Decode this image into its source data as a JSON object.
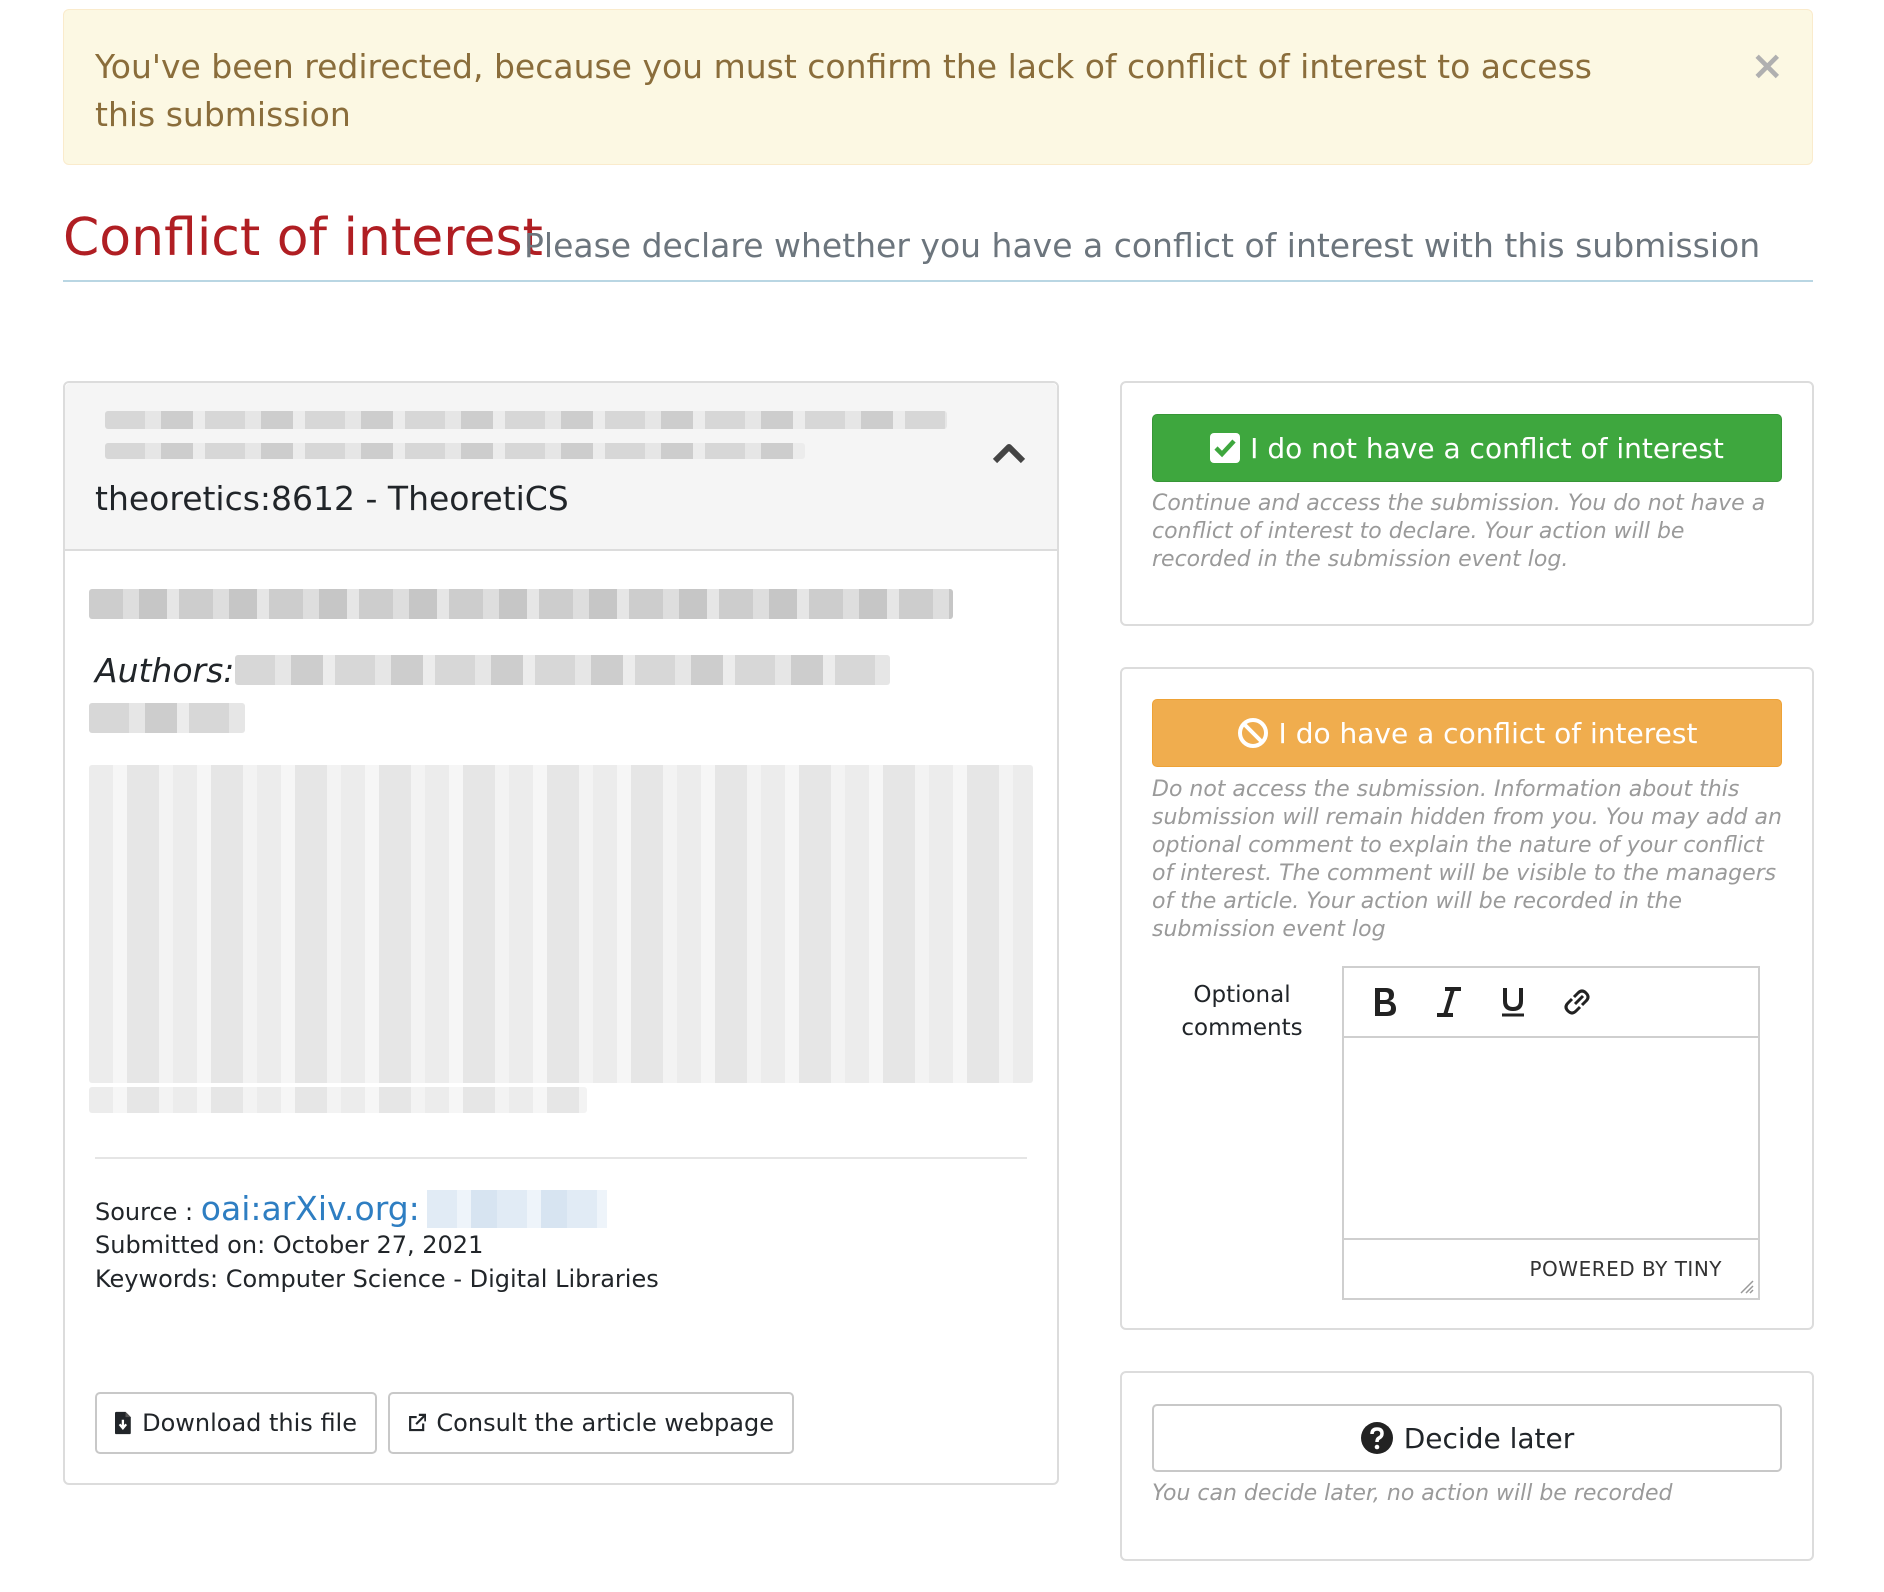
{
  "alert": {
    "message": "You've been redirected, because you must confirm the lack of conflict of interest to access this submission",
    "close_label": "×"
  },
  "header": {
    "title": "Conflict of interest",
    "subtitle": "Please declare whether you have a conflict of interest with this submission"
  },
  "submission": {
    "identifier": "theoretics:8612 - TheoretiCS",
    "authors_label": "Authors:",
    "source_label": "Source :",
    "source_link": "oai:arXiv.org:",
    "submitted": "Submitted on: October 27, 2021",
    "keywords": "Keywords: Computer Science - Digital Libraries",
    "download_label": "Download this file",
    "consult_label": "Consult the article webpage"
  },
  "no_conflict": {
    "button_label": "I do not have a conflict of interest",
    "help": "Continue and access the submission. You do not have a conflict of interest to declare. Your action will be recorded in the submission event log."
  },
  "conflict": {
    "button_label": "I do have a conflict of interest",
    "help": "Do not access the submission. Information about this submission will remain hidden from you. You may add an optional comment to explain the nature of your conflict of interest. The comment will be visible to the managers of the article. Your action will be recorded in the submission event log",
    "comments_label": "Optional comments",
    "editor_status": "POWERED BY TINY"
  },
  "later": {
    "button_label": "Decide later",
    "help": "You can decide later, no action will be recorded"
  },
  "colors": {
    "title_red": "#b01e23",
    "success_green": "#3ea73e",
    "warning_orange": "#f0ad4e",
    "link_blue": "#2e7ec2",
    "alert_bg": "#fcf8e3"
  }
}
